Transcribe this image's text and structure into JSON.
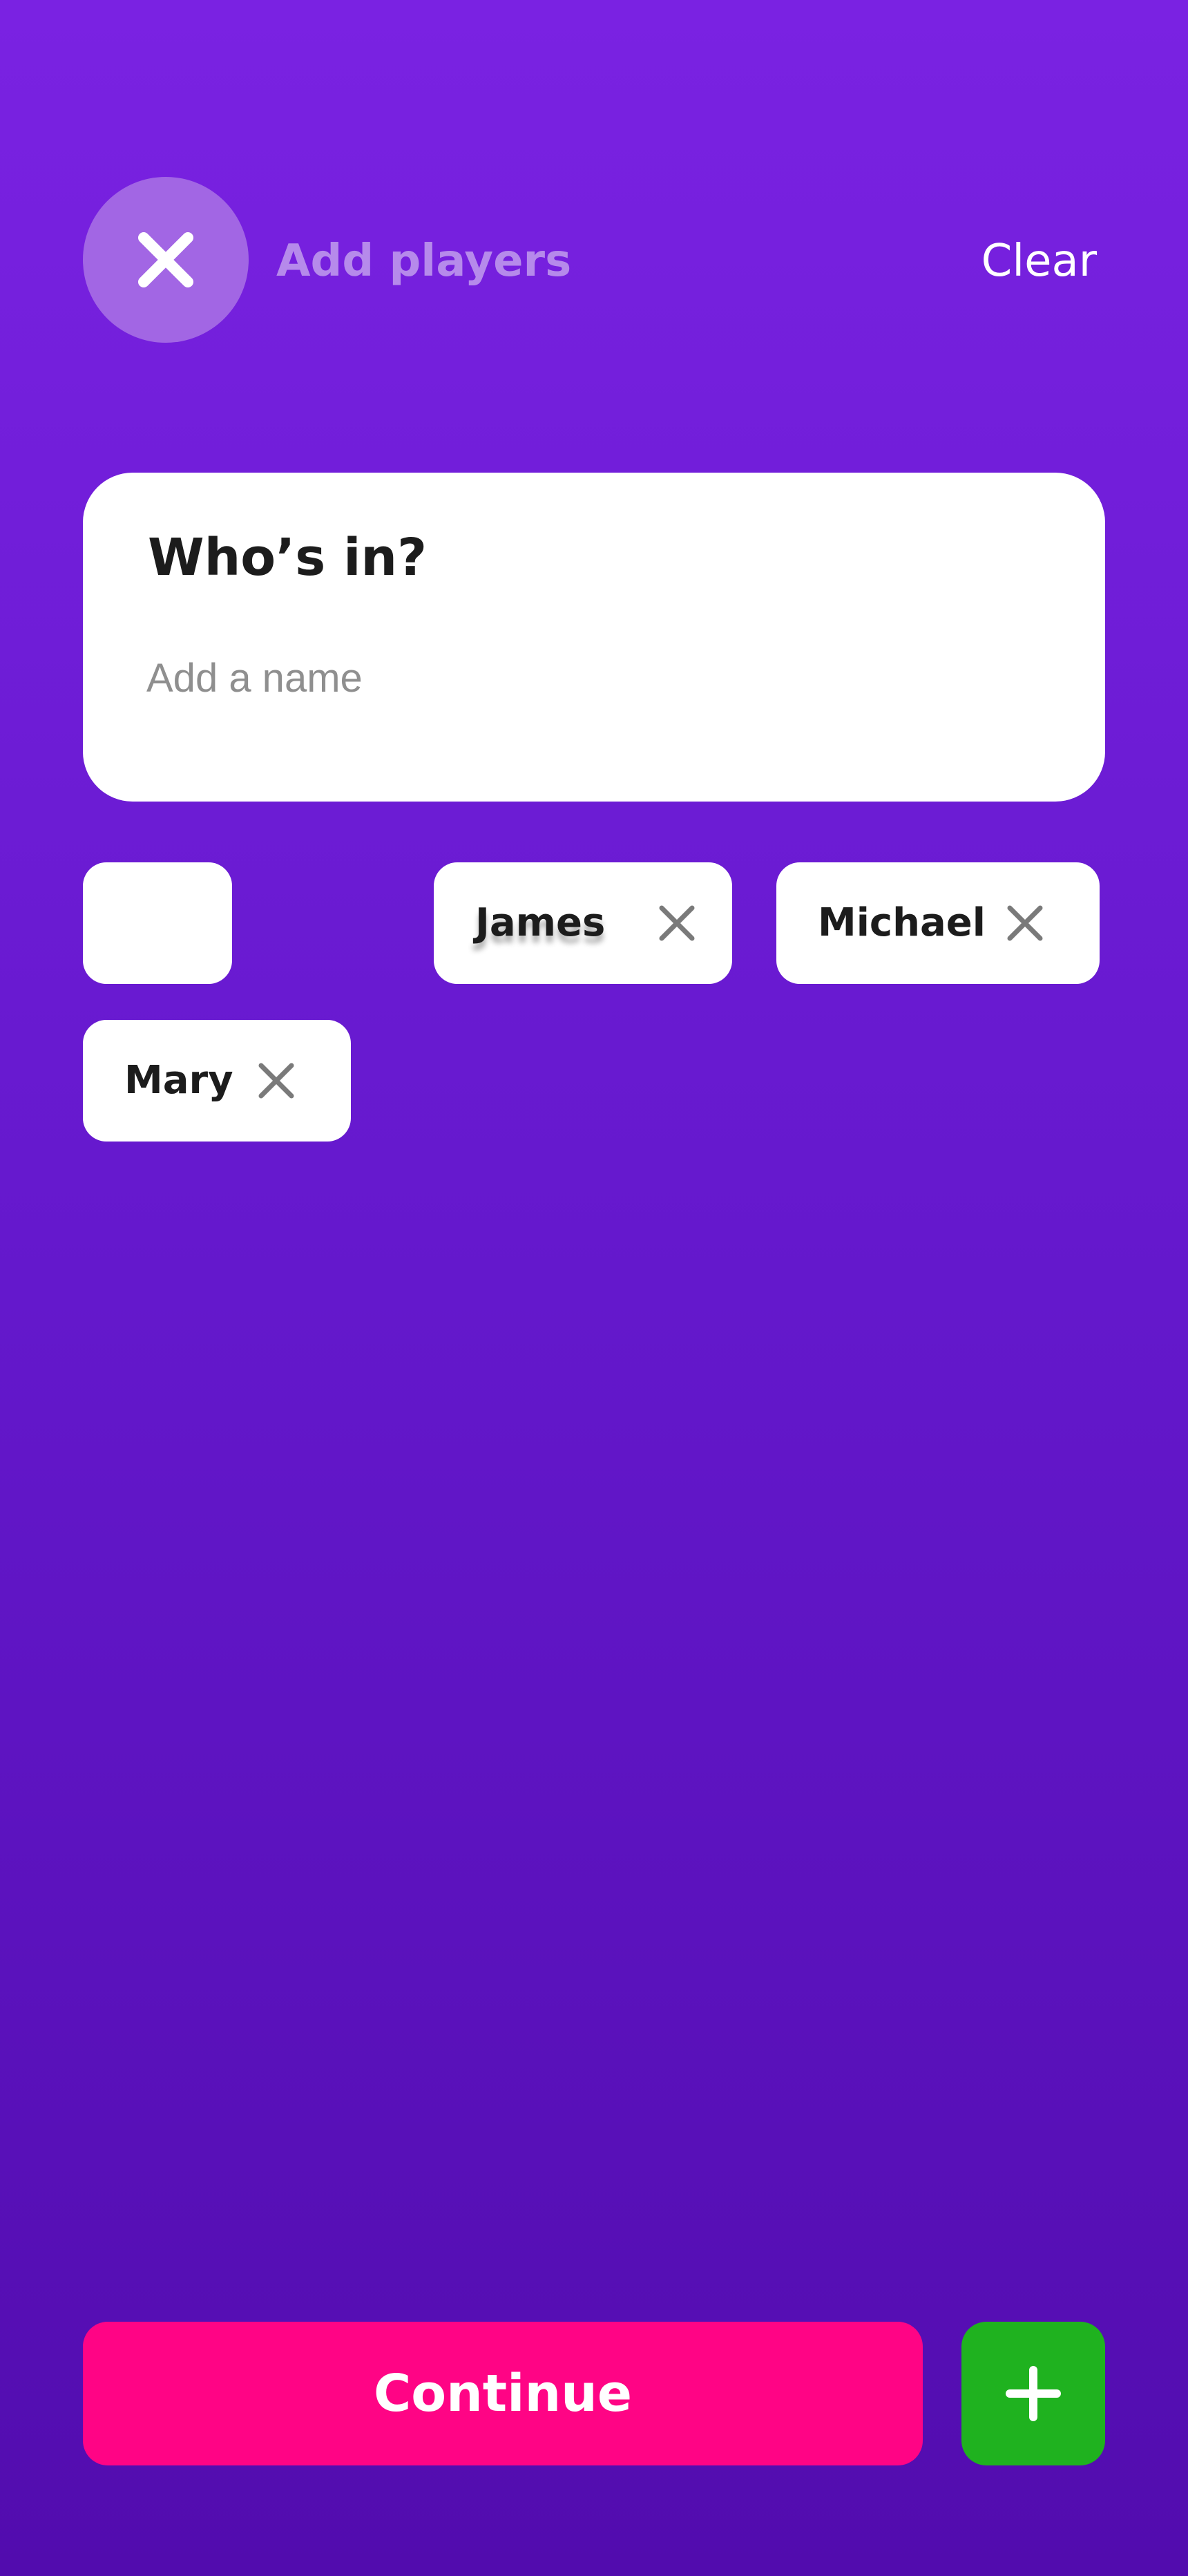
{
  "header": {
    "title": "Add players",
    "clear_label": "Clear",
    "close_icon": "close-icon"
  },
  "name_card": {
    "heading": "Who’s in?",
    "input_placeholder": "Add a name",
    "input_value": ""
  },
  "players": [
    {
      "name": ""
    },
    {
      "name": "James"
    },
    {
      "name": "Michael"
    },
    {
      "name": "Mary"
    }
  ],
  "footer": {
    "continue_label": "Continue",
    "add_icon": "plus-icon"
  },
  "colors": {
    "background_top": "#7a22e2",
    "background_bottom": "#520cae",
    "close_button": "#a266e4",
    "header_title": "#b68aeb",
    "continue_button": "#ff0485",
    "add_button": "#1fb21f",
    "remove_icon": "#7a7a7a"
  }
}
